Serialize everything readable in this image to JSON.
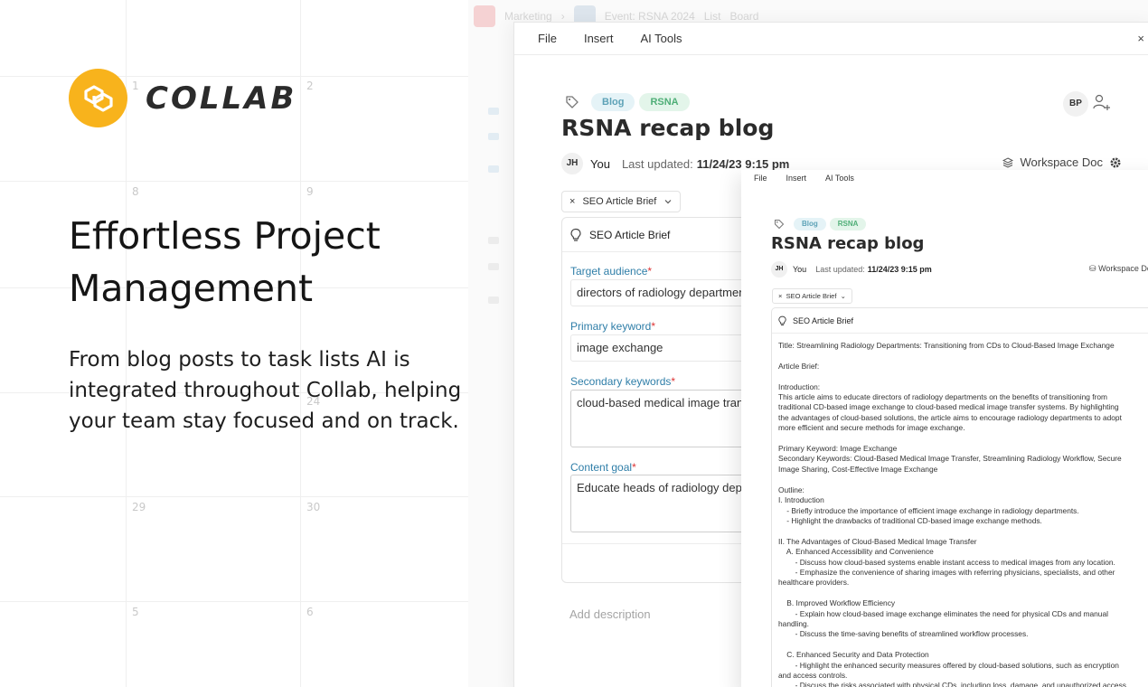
{
  "calendar": {
    "days": [
      "1",
      "2",
      "8",
      "9",
      "29",
      "30",
      "5",
      "6",
      "24"
    ]
  },
  "ghost": {
    "crumb1": "Marketing",
    "crumb2": "Event: RSNA 2024",
    "view1": "List",
    "view2": "Board"
  },
  "brand": {
    "name": "COLLAB",
    "accent": "#f8b31c"
  },
  "marketing": {
    "headline": "Effortless Project Management",
    "subtext": "From blog posts to task lists AI is integrated throughout Collab, helping your team stay focused and on track."
  },
  "doc": {
    "menu": [
      "File",
      "Insert",
      "AI Tools"
    ],
    "close_icon": "×",
    "tags": [
      "Blog",
      "RSNA"
    ],
    "title": "RSNA recap blog",
    "collaborator_initials": "BP",
    "author_initials": "JH",
    "author_label": "You",
    "updated_label": "Last updated:",
    "updated_value": "11/24/23 9:15 pm",
    "workspace_label": "Workspace Doc",
    "brief_chip": "SEO Article Brief",
    "card_title": "SEO Article Brief",
    "fields": {
      "target_audience_label": "Target audience",
      "target_audience_value": "directors of radiology departments",
      "primary_keyword_label": "Primary keyword",
      "primary_keyword_value": "image exchange",
      "secondary_keywords_label": "Secondary keywords",
      "secondary_keywords_value": "cloud-based medical image transfer",
      "content_goal_label": "Content goal",
      "content_goal_value": "Educate heads of radiology departments"
    },
    "required_mark": "*",
    "add_description": "Add description"
  },
  "overlay": {
    "menu": [
      "File",
      "Insert",
      "AI Tools"
    ],
    "tags": [
      "Blog",
      "RSNA"
    ],
    "title": "RSNA recap blog",
    "author_initials": "JH",
    "author_label": "You",
    "updated_label": "Last updated:",
    "updated_value": "11/24/23 9:15 pm",
    "workspace_label": "Workspace Doc",
    "brief_chip": "SEO Article Brief",
    "card_title": "SEO Article Brief",
    "content": "Title: Streamlining Radiology Departments: Transitioning from CDs to Cloud-Based Image Exchange\n\nArticle Brief:\n\nIntroduction:\nThis article aims to educate directors of radiology departments on the benefits of transitioning from\ntraditional CD-based image exchange to cloud-based medical image transfer systems. By highlighting\nthe advantages of cloud-based solutions, the article aims to encourage radiology departments to adopt\nmore efficient and secure methods for image exchange.\n\nPrimary Keyword: Image Exchange\nSecondary Keywords: Cloud-Based Medical Image Transfer, Streamlining Radiology Workflow, Secure\nImage Sharing, Cost-Effective Image Exchange\n\nOutline:\nI. Introduction\n    - Briefly introduce the importance of efficient image exchange in radiology departments.\n    - Highlight the drawbacks of traditional CD-based image exchange methods.\n\nII. The Advantages of Cloud-Based Medical Image Transfer\n    A. Enhanced Accessibility and Convenience\n        - Discuss how cloud-based systems enable instant access to medical images from any location.\n        - Emphasize the convenience of sharing images with referring physicians, specialists, and other\nhealthcare providers.\n\n    B. Improved Workflow Efficiency\n        - Explain how cloud-based image exchange eliminates the need for physical CDs and manual\nhandling.\n        - Discuss the time-saving benefits of streamlined workflow processes.\n\n    C. Enhanced Security and Data Protection\n        - Highlight the enhanced security measures offered by cloud-based solutions, such as encryption\nand access controls.\n        - Discuss the risks associated with physical CDs, including loss, damage, and unauthorized access."
  }
}
